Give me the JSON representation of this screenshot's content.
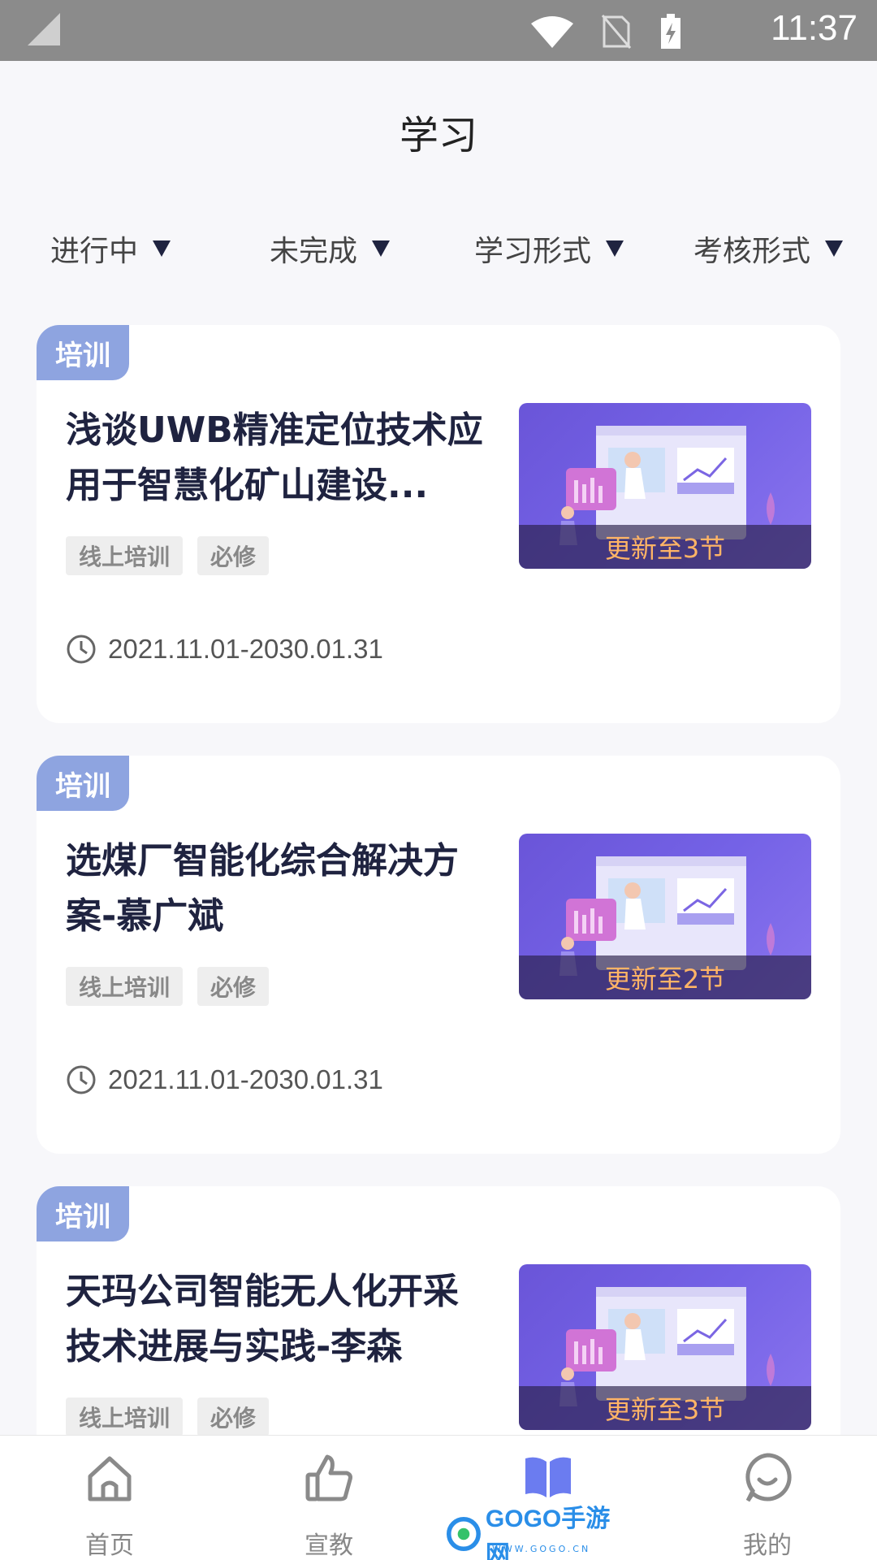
{
  "status_bar": {
    "time": "11:37"
  },
  "header": {
    "title": "学习"
  },
  "filters": [
    {
      "label": "进行中"
    },
    {
      "label": "未完成"
    },
    {
      "label": "学习形式"
    },
    {
      "label": "考核形式"
    }
  ],
  "courses": [
    {
      "tag": "培训",
      "title": "浅谈UWB精准定位技术应用于智慧化矿山建设...",
      "badges": [
        "线上培训",
        "必修"
      ],
      "update": "更新至3节",
      "date": "2021.11.01-2030.01.31"
    },
    {
      "tag": "培训",
      "title": "选煤厂智能化综合解决方案-慕广斌",
      "badges": [
        "线上培训",
        "必修"
      ],
      "update": "更新至2节",
      "date": "2021.11.01-2030.01.31"
    },
    {
      "tag": "培训",
      "title": "天玛公司智能无人化开采技术进展与实践-李森",
      "badges": [
        "线上培训",
        "必修"
      ],
      "update": "更新至3节",
      "date": ""
    }
  ],
  "tabbar": [
    {
      "label": "首页",
      "icon": "home-icon"
    },
    {
      "label": "宣教",
      "icon": "thumbs-up-icon"
    },
    {
      "label": "",
      "icon": "book-icon",
      "active": true
    },
    {
      "label": "我的",
      "icon": "profile-icon"
    }
  ],
  "watermark": {
    "text": "GOGO手游网",
    "sub": "WWW.GOGO.CN"
  },
  "colors": {
    "accent": "#6b7cf0",
    "tag": "#8ea4e0",
    "update_text": "#ffb466",
    "thumb": "#6a55d8"
  }
}
